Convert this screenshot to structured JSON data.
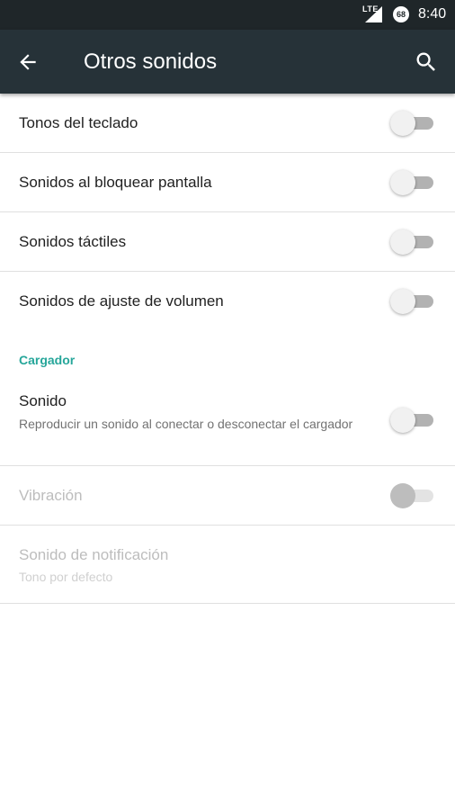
{
  "status_bar": {
    "network": "LTE",
    "battery_level": "68",
    "time": "8:40"
  },
  "app_bar": {
    "title": "Otros sonidos"
  },
  "settings": [
    {
      "label": "Tonos del teclado",
      "enabled": false
    },
    {
      "label": "Sonidos al bloquear pantalla",
      "enabled": false
    },
    {
      "label": "Sonidos táctiles",
      "enabled": false
    },
    {
      "label": "Sonidos de ajuste de volumen",
      "enabled": false
    }
  ],
  "cargador": {
    "header": "Cargador",
    "sonido": {
      "label": "Sonido",
      "summary": "Reproducir un sonido al conectar o desconectar el cargador",
      "enabled": false
    },
    "vibracion": {
      "label": "Vibración",
      "enabled": false,
      "disabled": true
    },
    "notificacion": {
      "label": "Sonido de notificación",
      "summary": "Tono por defecto",
      "disabled": true
    }
  },
  "colors": {
    "status_bar": "#1f2629",
    "app_bar": "#263238",
    "accent": "#26a69a",
    "divider": "#e0e0e0"
  }
}
